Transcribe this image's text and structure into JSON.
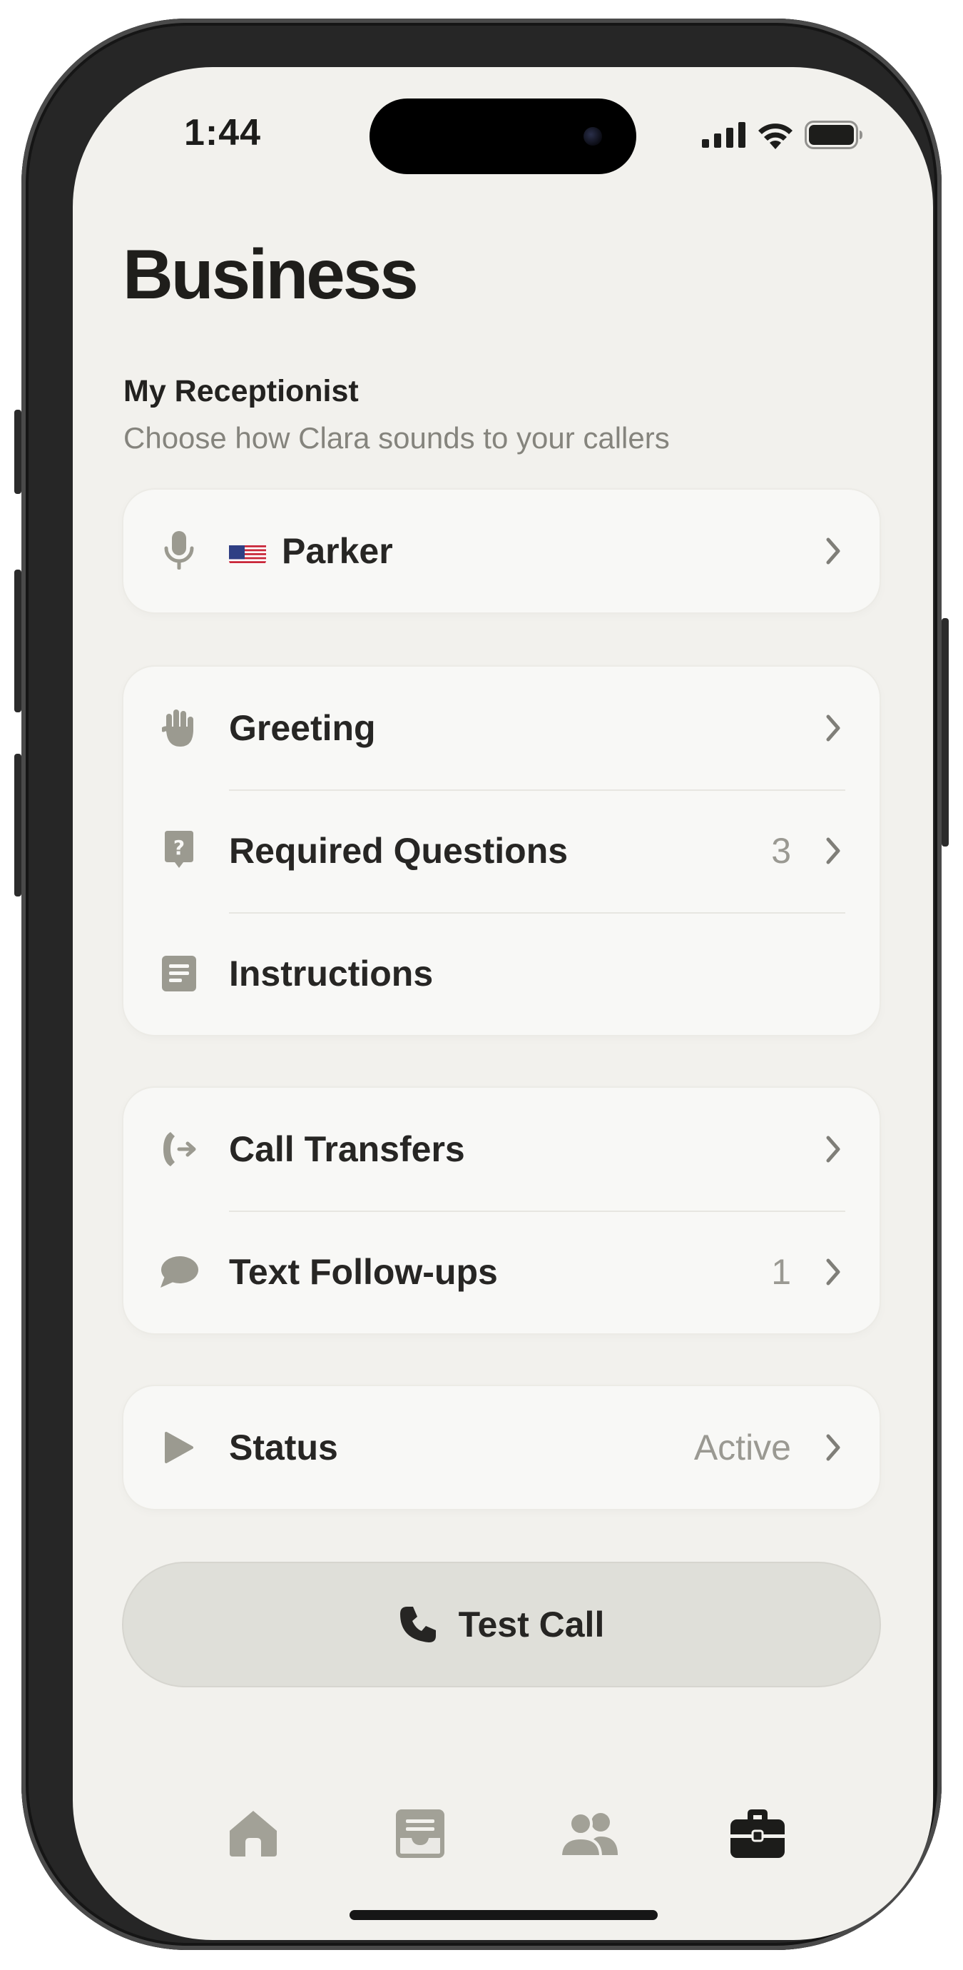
{
  "status_bar": {
    "time": "1:44"
  },
  "page": {
    "title": "Business"
  },
  "receptionist": {
    "title": "My Receptionist",
    "subtitle": "Choose how Clara sounds to your callers",
    "voice": {
      "name": "Parker",
      "flag": "us-flag",
      "icon": "microphone-icon"
    }
  },
  "setup_group": {
    "items": [
      {
        "label": "Greeting",
        "icon": "raised-hand-icon",
        "value": ""
      },
      {
        "label": "Required Questions",
        "icon": "question-bubble-icon",
        "value": "3"
      },
      {
        "label": "Instructions",
        "icon": "document-icon",
        "value": ""
      }
    ]
  },
  "communication_group": {
    "items": [
      {
        "label": "Call Transfers",
        "icon": "phone-transfer-icon",
        "value": ""
      },
      {
        "label": "Text Follow-ups",
        "icon": "chat-bubble-icon",
        "value": "1"
      }
    ]
  },
  "status_card": {
    "label": "Status",
    "value": "Active",
    "icon": "play-icon"
  },
  "test_call": {
    "label": "Test Call",
    "icon": "phone-icon"
  },
  "tab_bar": {
    "tabs": [
      {
        "name": "home",
        "icon": "home-icon",
        "active": false
      },
      {
        "name": "inbox",
        "icon": "inbox-icon",
        "active": false
      },
      {
        "name": "contacts",
        "icon": "people-icon",
        "active": false
      },
      {
        "name": "business",
        "icon": "briefcase-icon",
        "active": true
      }
    ]
  },
  "colors": {
    "background": "#f2f1ed",
    "card": "#f8f8f6",
    "icon": "#9b9a90",
    "text": "#272624",
    "muted": "#9a9992",
    "button": "#dfdfd9"
  }
}
